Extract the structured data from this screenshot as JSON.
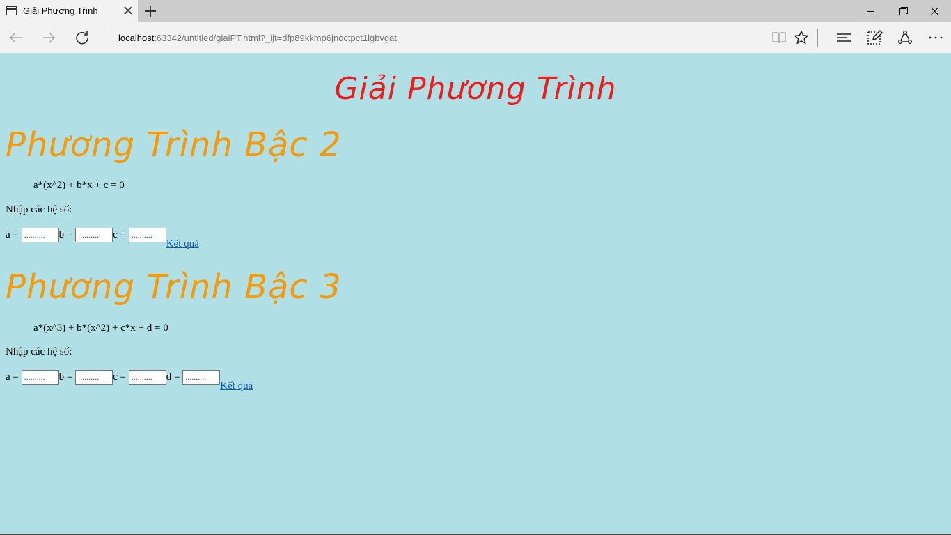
{
  "browser": {
    "tab_title": "Giải Phương Trình",
    "address_host": "localhost",
    "address_path": ":63342/untitled/giaiPT.html?_ijt=dfp89kkmp6jnoctpct1lgbvgat"
  },
  "page": {
    "title": "Giải Phương Trình",
    "sections": [
      {
        "heading": "Phương Trình Bậc 2",
        "formula": "a*(x^2) + b*x + c = 0",
        "prompt": "Nhập các hệ số:",
        "fields": [
          {
            "label": "a =",
            "placeholder": ".........."
          },
          {
            "label": "b =",
            "placeholder": ".........."
          },
          {
            "label": "c =",
            "placeholder": ".........."
          }
        ],
        "result_link": "Kết quả"
      },
      {
        "heading": "Phương Trình Bậc 3",
        "formula": "a*(x^3) + b*(x^2) + c*x + d = 0",
        "prompt": "Nhập các hệ số:",
        "fields": [
          {
            "label": "a =",
            "placeholder": ".........."
          },
          {
            "label": "b =",
            "placeholder": ".........."
          },
          {
            "label": "c =",
            "placeholder": ".........."
          },
          {
            "label": "d =",
            "placeholder": ".........."
          }
        ],
        "result_link": "Kết quả"
      }
    ]
  },
  "colors": {
    "background": "#b0dfe5",
    "title": "#ee1c1c",
    "section_heading": "#f49a0c",
    "link": "#0b5fbd"
  }
}
